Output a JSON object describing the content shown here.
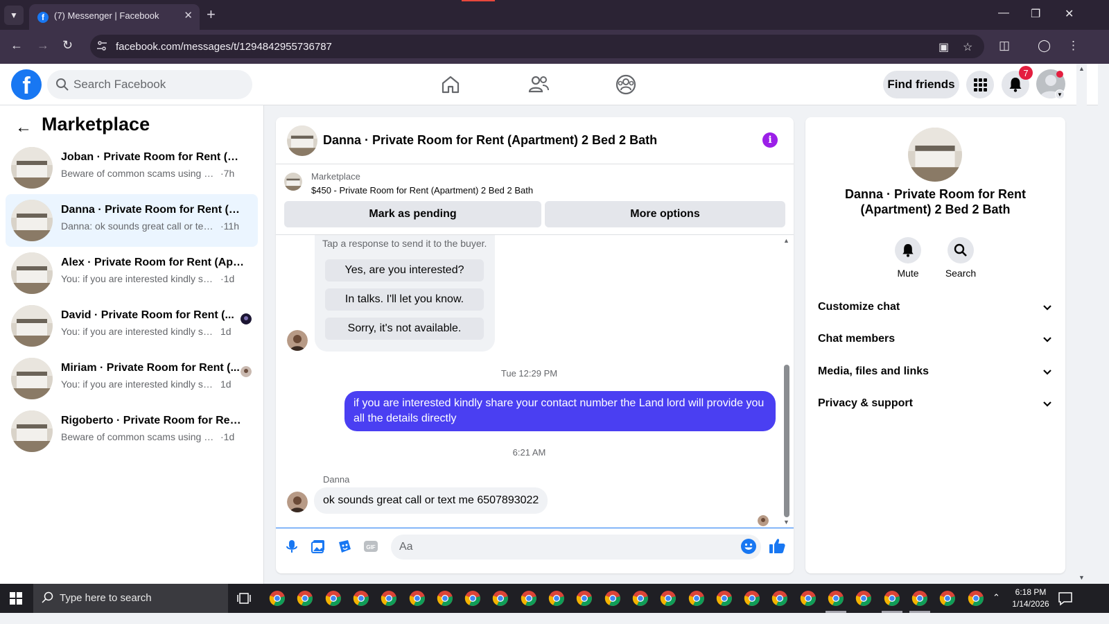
{
  "browser": {
    "tab_title": "(7) Messenger | Facebook",
    "url": "facebook.com/messages/t/1294842955736787"
  },
  "header": {
    "search_placeholder": "Search Facebook",
    "find_friends": "Find friends",
    "notification_count": "7"
  },
  "sidebar": {
    "title": "Marketplace",
    "conversations": [
      {
        "name": "Joban · Private Room for Rent (Ap...",
        "preview": "Beware of common scams using pay...",
        "time": "·7h"
      },
      {
        "name": "Danna · Private Room for Rent (Ap...",
        "preview": "Danna: ok sounds great call or text ...",
        "time": "·11h"
      },
      {
        "name": "Alex · Private Room for Rent (Apar...",
        "preview": "You: if you are interested kindly share ...",
        "time": "·1d"
      },
      {
        "name": "David · Private Room for Rent (...",
        "preview": "You: if you are interested kindly sha...",
        "time": "1d"
      },
      {
        "name": "Miriam · Private Room for Rent (...",
        "preview": "You: if you are interested kindly sha...",
        "time": "1d"
      },
      {
        "name": "Rigoberto · Private Room for Rent ...",
        "preview": "Beware of common scams using pay...",
        "time": "·1d"
      }
    ]
  },
  "chat": {
    "title": "Danna · Private Room for Rent (Apartment) 2 Bed 2 Bath",
    "listing_label": "Marketplace",
    "listing_title": "$450 - Private Room for Rent (Apartment) 2 Bed 2 Bath",
    "mark_pending": "Mark as pending",
    "more_options": "More options",
    "quick_hint": "Tap a response to send it to the buyer.",
    "quick_replies": [
      "Yes, are you interested?",
      "In talks. I'll let you know.",
      "Sorry, it's not available."
    ],
    "timestamp_1": "Tue 12:29 PM",
    "outgoing_message": "if you are interested kindly share your contact number the Land lord will provide you all the details directly",
    "timestamp_2": "6:21 AM",
    "sender_name": "Danna",
    "incoming_message": "ok sounds great call or text me 6507893022",
    "composer_placeholder": "Aa"
  },
  "details": {
    "name": "Danna · Private Room for Rent (Apartment) 2 Bed 2 Bath",
    "mute_label": "Mute",
    "search_label": "Search",
    "sections": [
      "Customize chat",
      "Chat members",
      "Media, files and links",
      "Privacy & support"
    ]
  },
  "taskbar": {
    "search_placeholder": "Type here to search",
    "time": "6:18 PM",
    "date": "1/14/2026"
  },
  "colors": {
    "brand": "#1877f2",
    "outgoing_bubble": "#4a3ff2",
    "info_accent": "#9b1fe8",
    "badge": "#e41e3f"
  }
}
